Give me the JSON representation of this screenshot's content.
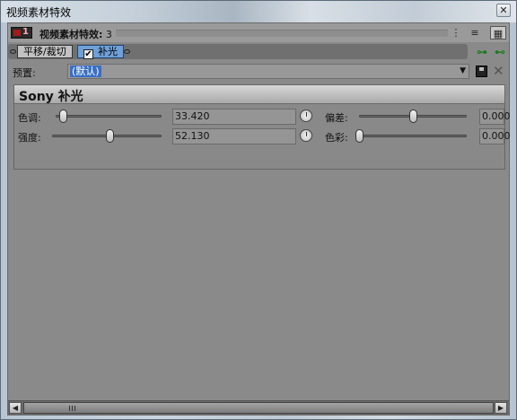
{
  "window": {
    "title": "视频素材特效",
    "close_glyph": "✕"
  },
  "header": {
    "badge_number": "1",
    "label": "视频素材特效:",
    "count": "3",
    "icons": [
      "vertical-dots-icon",
      "list-view-icon",
      "grid-view-icon"
    ]
  },
  "chain": {
    "items": [
      {
        "label": "平移/裁切",
        "selected": false,
        "checked": false
      },
      {
        "label": "补光",
        "selected": true,
        "checked": true
      }
    ],
    "buttons": [
      "insert-plugin-icon",
      "remove-plugin-icon"
    ]
  },
  "preset": {
    "label": "预置:",
    "value": "(默认)",
    "dropdown_glyph": "▼",
    "delete_glyph": "✕"
  },
  "plugin": {
    "title": "Sony 补光",
    "params": [
      {
        "label": "色调:",
        "value": "33.420",
        "level": 0.05
      },
      {
        "label": "强度:",
        "value": "52.130",
        "level": 0.52
      },
      {
        "label": "偏差:",
        "value": "0.000",
        "level": 0.5
      },
      {
        "label": "色彩:",
        "value": "0.000",
        "level": 0.0
      }
    ]
  },
  "scrollbar": {
    "left_glyph": "◀",
    "right_glyph": "▶"
  },
  "colors": {
    "selected_chain": "#6fa0d8",
    "preset_highlight": "#3a6fc4",
    "accent_green": "#1b7a1b"
  }
}
